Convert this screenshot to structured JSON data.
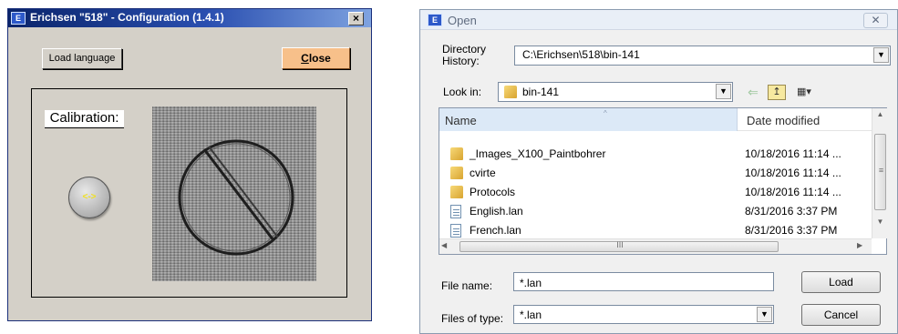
{
  "config_window": {
    "title": "Erichsen \"518\" - Configuration (1.4.1)",
    "app_icon": "E",
    "close_x": "×",
    "load_language_label": "Load language",
    "close_label_underlined": "C",
    "close_label_rest": "lose",
    "calibration_label": "Calibration:",
    "toggle_label": "<->",
    "colors": {
      "titlebar": "#0a246a",
      "close_button": "#f7c08a",
      "toggle_text": "#f0e020"
    }
  },
  "open_dialog": {
    "title": "Open",
    "app_icon": "E",
    "close_x": "✕",
    "directory_history_label_1": "Directory",
    "directory_history_label_2": "History:",
    "directory_history_value": "C:\\Erichsen\\518\\bin-141",
    "look_in_label": "Look in:",
    "look_in_value": "bin-141",
    "dropdown_arrow": "▼",
    "toolbar": {
      "back": "⇐",
      "up": "↥",
      "view": "▦▾"
    },
    "columns": {
      "name": "Name",
      "date": "Date modified",
      "sort_arrow": "^"
    },
    "files": [
      {
        "name": "_Images_X100_Paintbohrer",
        "date": "10/18/2016 11:14 ...",
        "kind": "folder"
      },
      {
        "name": "cvirte",
        "date": "10/18/2016 11:14 ...",
        "kind": "folder"
      },
      {
        "name": "Protocols",
        "date": "10/18/2016 11:14 ...",
        "kind": "folder"
      },
      {
        "name": "English.lan",
        "date": "8/31/2016 3:37 PM",
        "kind": "file"
      },
      {
        "name": "French.lan",
        "date": "8/31/2016 3:37 PM",
        "kind": "file"
      }
    ],
    "scroll": {
      "up": "▲",
      "down": "▼",
      "left": "◀",
      "right": "▶",
      "grip_v": "≡",
      "grip_h": "III"
    },
    "file_name_label": "File name:",
    "file_name_value": "*.lan",
    "files_of_type_label": "Files of type:",
    "files_of_type_value": "*.lan",
    "load_label": "Load",
    "cancel_label": "Cancel"
  }
}
